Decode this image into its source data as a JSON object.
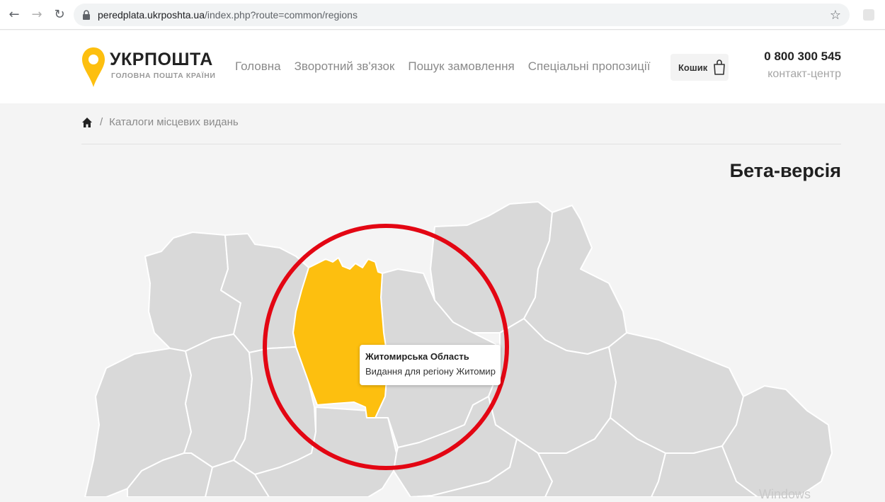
{
  "browser": {
    "url_host": "peredplata.ukrposhta.ua",
    "url_path": "/index.php?route=common/regions",
    "icons": [
      "back-arrow-icon",
      "forward-arrow-icon",
      "reload-icon",
      "lock-icon",
      "star-icon"
    ]
  },
  "header": {
    "logo_title": "УКРПОШТА",
    "logo_subtitle": "ГОЛОВНА ПОШТА КРАЇНИ",
    "nav": [
      {
        "label": "Головна"
      },
      {
        "label": "Зворотний зв'язок"
      },
      {
        "label": "Пошук замовлення"
      },
      {
        "label": "Спеціальні пропозиції"
      }
    ],
    "cart_label": "Кошик",
    "phone": "0 800 300 545",
    "phone_label": "контакт-центр"
  },
  "breadcrumb": {
    "current": "Каталоги місцевих видань"
  },
  "page_title": "Бета-версія",
  "map": {
    "highlighted_region": "Житомирська Область",
    "tooltip": {
      "title": "Житомирська Область",
      "subtitle": "Видання для регіону Житомир"
    },
    "colors": {
      "region": "#d9d9d9",
      "region_border": "#ffffff",
      "highlight": "#fdbf0f",
      "annotation_circle": "#e30613"
    }
  },
  "watermark": "Windows"
}
